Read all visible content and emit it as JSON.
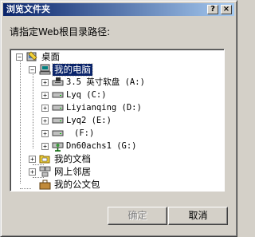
{
  "window": {
    "title": "浏览文件夹",
    "help_glyph": "?",
    "close_glyph": "×"
  },
  "prompt": "请指定Web根目录路径:",
  "tree": {
    "root": {
      "label": "桌面",
      "expander": "−",
      "icon": "desktop-icon"
    },
    "my_computer": {
      "label": "我的电脑",
      "expander": "−",
      "icon": "computer-icon"
    },
    "drives": [
      {
        "label": "3.5 英寸软盘 (A:)",
        "expander": "+",
        "icon": "floppy-drive-icon"
      },
      {
        "label": "Lyq (C:)",
        "expander": "+",
        "icon": "hard-drive-icon"
      },
      {
        "label": "Liyianqing (D:)",
        "expander": "+",
        "icon": "hard-drive-icon"
      },
      {
        "label": "Lyq2 (E:)",
        "expander": "+",
        "icon": "hard-drive-icon"
      },
      {
        "label": "(F:)",
        "expander": "+",
        "icon": "hard-drive-icon"
      },
      {
        "label": "Dn60achs1 (G:)",
        "expander": "+",
        "icon": "network-drive-icon"
      }
    ],
    "others": [
      {
        "label": "我的文档",
        "expander": "+",
        "icon": "documents-folder-icon"
      },
      {
        "label": "网上邻居",
        "expander": "+",
        "icon": "network-icon"
      },
      {
        "label": "我的公文包",
        "expander": "",
        "icon": "briefcase-icon"
      }
    ]
  },
  "buttons": {
    "ok": "确定",
    "cancel": "取消"
  },
  "colors": {
    "titlebar_start": "#0a246a",
    "titlebar_end": "#a6caf0",
    "selection": "#0a246a",
    "face": "#d4d0c8"
  }
}
